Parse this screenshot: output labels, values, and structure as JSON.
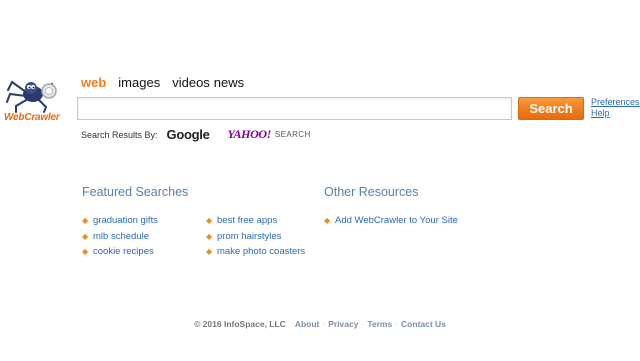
{
  "brand": {
    "logo_text": "WebCrawler",
    "accent": "#f07c1f",
    "link_color": "#2a6ab8"
  },
  "tabs": [
    {
      "label": "web",
      "active": true
    },
    {
      "label": "images",
      "active": false
    },
    {
      "label": "videos",
      "active": false
    },
    {
      "label": "news",
      "active": false
    }
  ],
  "search": {
    "value": "",
    "placeholder": "",
    "button_label": "Search"
  },
  "side_links": {
    "preferences": "Preferences",
    "help": "Help"
  },
  "results_by": {
    "label": "Search Results By:",
    "google": "Google",
    "yahoo": "YAHOO!",
    "yahoo_suffix": "SEARCH"
  },
  "featured": {
    "title": "Featured Searches",
    "col1": [
      "graduation gifts",
      "mlb schedule",
      "cookie recipes"
    ],
    "col2": [
      "best free apps",
      "prom hairstyles",
      "make photo coasters"
    ]
  },
  "resources": {
    "title": "Other Resources",
    "items": [
      "Add WebCrawler to Your Site"
    ]
  },
  "footer": {
    "copyright": "© 2016 InfoSpace, LLC",
    "links": [
      "About",
      "Privacy",
      "Terms",
      "Contact Us"
    ]
  }
}
